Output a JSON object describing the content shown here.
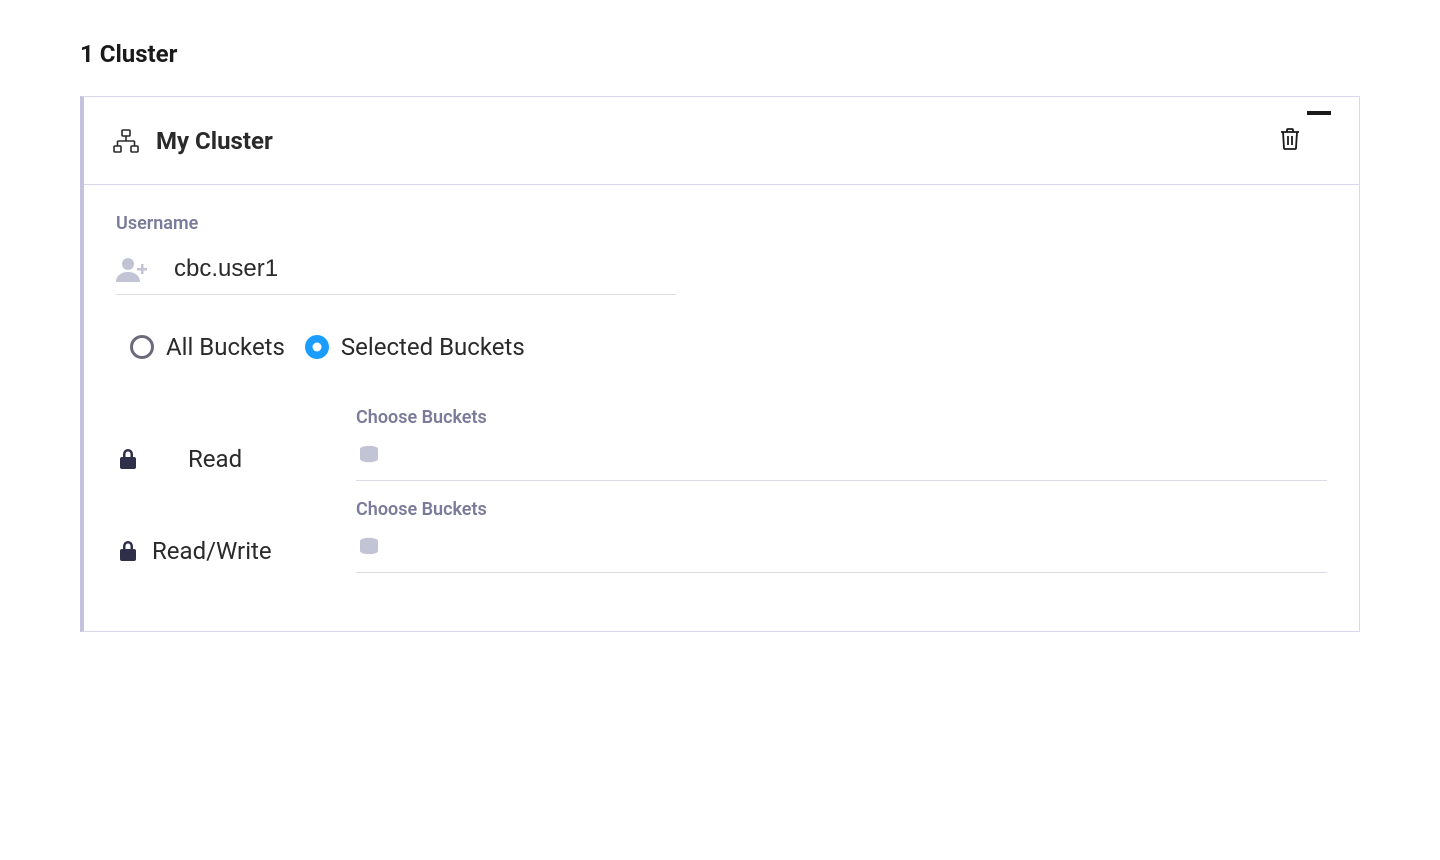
{
  "page": {
    "title": "1 Cluster"
  },
  "cluster": {
    "name": "My Cluster",
    "username_label": "Username",
    "username_value": "cbc.user1",
    "scope": {
      "all_label": "All Buckets",
      "selected_label": "Selected Buckets"
    },
    "permissions": {
      "read": {
        "label": "Read",
        "choose_label": "Choose Buckets",
        "value": ""
      },
      "readwrite": {
        "label": "Read/Write",
        "choose_label": "Choose Buckets",
        "value": ""
      }
    }
  }
}
